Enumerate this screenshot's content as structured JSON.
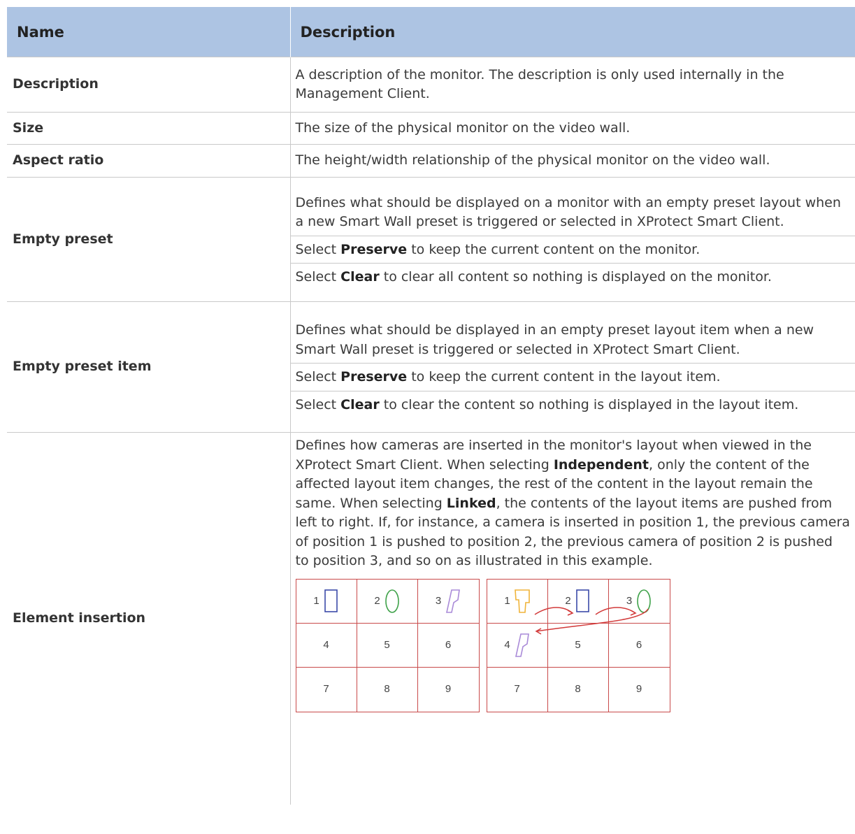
{
  "table": {
    "headers": {
      "name": "Name",
      "description": "Description"
    },
    "rows": [
      {
        "name": "Description",
        "text": "A description of the monitor. The description is only used internally in the Management Client."
      },
      {
        "name": "Size",
        "text": "The size of the physical monitor on the video wall."
      },
      {
        "name": "Aspect ratio",
        "text": "The height/width relationship of the physical monitor on the video wall."
      },
      {
        "name": "Empty preset",
        "p1": "Defines what should be displayed on a monitor with an empty preset layout when a new Smart Wall preset is triggered or selected in XProtect Smart Client.",
        "p2_pre": "Select ",
        "p2_bold": "Preserve",
        "p2_post": " to keep the current content on the monitor.",
        "p3_pre": "Select ",
        "p3_bold": "Clear",
        "p3_post": " to clear all content so nothing is displayed on the monitor."
      },
      {
        "name": "Empty preset item",
        "p1": "Defines what should be displayed in an empty preset layout item when a new Smart Wall preset is triggered or selected in XProtect Smart Client.",
        "p2_pre": "Select ",
        "p2_bold": "Preserve",
        "p2_post": " to keep the current content in the layout item.",
        "p3_pre": "Select ",
        "p3_bold": "Clear",
        "p3_post": " to clear the content so nothing is displayed in the layout item."
      },
      {
        "name": "Element insertion",
        "t1": "Defines how cameras are inserted in the monitor's layout when viewed in the XProtect Smart Client. When selecting ",
        "b1": "Independent",
        "t2": ", only the content of the affected layout item changes, the rest of the content in the layout remain the same. When selecting ",
        "b2": "Linked",
        "t3": ", the contents of the layout items are pushed from left to right. If, for instance, a camera is inserted in position 1, the previous camera of position 1 is pushed to position 2, the previous camera of position 2 is pushed to position 3, and so on as illustrated in this example."
      }
    ]
  },
  "illustration": {
    "left_grid": [
      "1",
      "2",
      "3",
      "4",
      "5",
      "6",
      "7",
      "8",
      "9"
    ],
    "right_grid": [
      "1",
      "2",
      "3",
      "4",
      "5",
      "6",
      "7",
      "8",
      "9"
    ],
    "colors": {
      "grid_line": "#c94a4a",
      "rectangle": "#3b4aa8",
      "oval": "#3fa24a",
      "parallelogram": "#a98ad8",
      "trapezoid": "#f0b43a",
      "arrow": "#d23a3a"
    }
  }
}
